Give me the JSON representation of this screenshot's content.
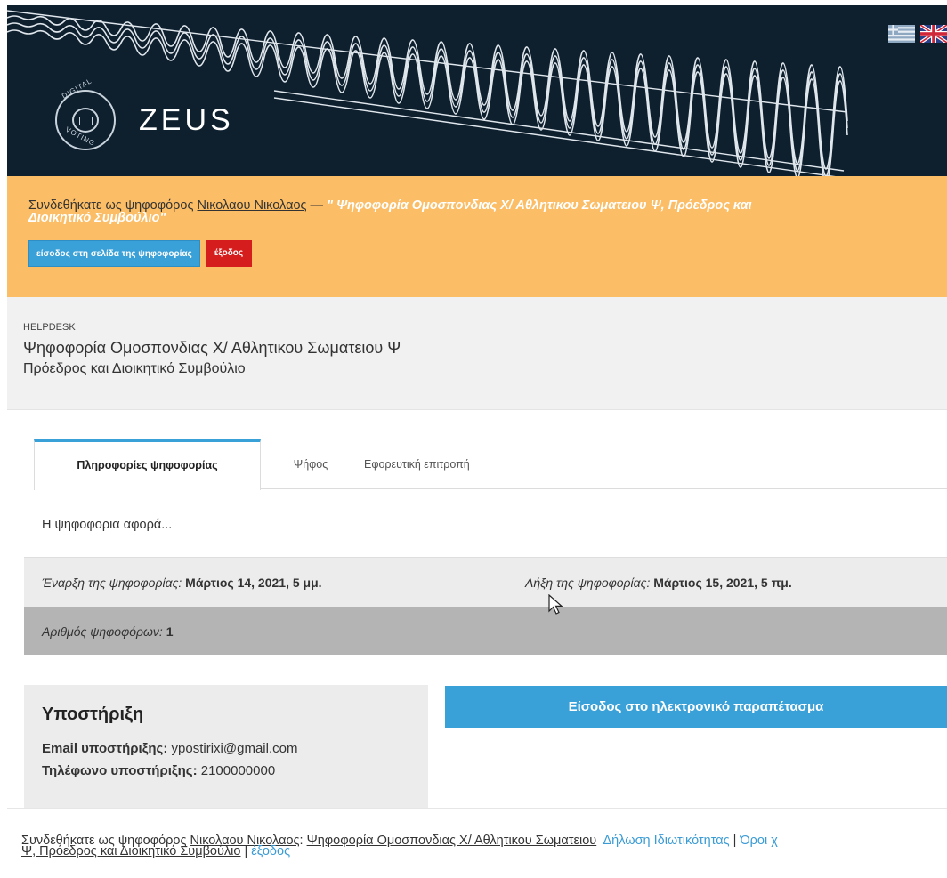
{
  "header": {
    "brand": "ZEUS",
    "logo_top_text": "DIGITAL",
    "logo_bottom_text": "VOTING",
    "languages": [
      "greek-flag-icon",
      "uk-flag-icon"
    ]
  },
  "banner": {
    "prefix": "Συνδεθήκατε ως ψηφοφόρος",
    "voter_name": "Νικολαου Νικολαος",
    "separator": " — ",
    "election_line1": "\" Ψηφοφορία Ομοσπονδιας Χ/ Αθλητικου Σωματειου Ψ, Πρόεδρος και",
    "election_line2": "Διοικητικό Συμβούλιο\"",
    "enter_button": "είσοδος στη σελίδα της ψηφοφορίας",
    "logout_button": "έξοδος"
  },
  "title_area": {
    "label": "HELPDESK",
    "title": "Ψηφοφορία Ομοσπονδιας Χ/ Αθλητικου Σωματειου Ψ",
    "subtitle": "Πρόεδρος και Διοικητικό Συμβούλιο"
  },
  "tabs": [
    {
      "label": "Πληροφορίες ψηφοφορίας",
      "active": true
    },
    {
      "label": "Ψήφος",
      "active": false
    },
    {
      "label": "Εφορευτική επιτροπή",
      "active": false
    }
  ],
  "about": "Η ψηφοφορια αφορά...",
  "info": {
    "start_label": "Έναρξη της ψηφοφορίας:",
    "start_value": "Μάρτιος 14, 2021, 5 μμ.",
    "end_label": "Λήξη της ψηφοφορίας:",
    "end_value": "Μάρτιος 15, 2021, 5 πμ.",
    "voters_label": "Αριθμός ψηφοφόρων:",
    "voters_value": "1"
  },
  "support": {
    "heading": "Υποστήριξη",
    "email_label": "Email υποστήριξης:",
    "email_value": "ypostirixi@gmail.com",
    "phone_label": "Τηλέφωνο υποστήριξης:",
    "phone_value": "2100000000"
  },
  "booth_button": "Είσοδος στο ηλεκτρονικό παραπέτασμα",
  "footer": {
    "prefix": "Συνδεθήκατε ως ψηφοφόρος",
    "voter_name": "Νικολαου Νικολαος",
    "election_part1": "Ψηφοφορία Ομοσπονδιας Χ/ Αθλητικου Σωματειου",
    "election_part2": "Ψ, Πρόεδρος και Διοικητικό Συμβούλιο",
    "privacy_link": "Δήλωση Ιδιωτικότητας",
    "terms_link": "Όροι χ",
    "logout_link": "έξοδος"
  },
  "colors": {
    "header_bg": "#0e1f2e",
    "banner_bg": "#fbbd66",
    "accent_blue": "#3aa0d8",
    "danger_red": "#d51d1d",
    "link_blue": "#3a9bd5"
  }
}
